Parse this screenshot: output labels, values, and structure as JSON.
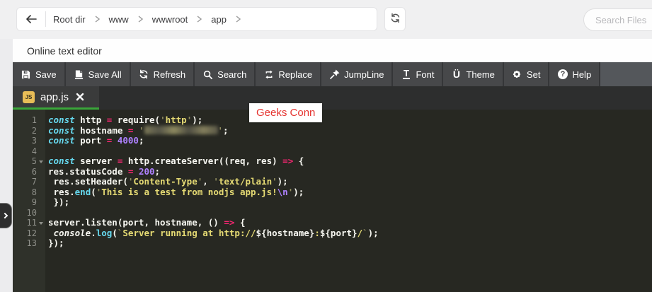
{
  "topbar": {
    "breadcrumb": [
      "Root dir",
      "www",
      "wwwroot",
      "app"
    ],
    "search_placeholder": "Search Files"
  },
  "header": {
    "title": "Online text editor"
  },
  "toolbar": {
    "buttons": [
      {
        "label": "Save",
        "icon": "save-icon"
      },
      {
        "label": "Save All",
        "icon": "save-all-icon"
      },
      {
        "label": "Refresh",
        "icon": "refresh-icon"
      },
      {
        "label": "Search",
        "icon": "search-icon"
      },
      {
        "label": "Replace",
        "icon": "replace-icon"
      },
      {
        "label": "JumpLine",
        "icon": "pin-icon"
      },
      {
        "label": "Font",
        "icon": "font-icon"
      },
      {
        "label": "Theme",
        "icon": "theme-icon"
      },
      {
        "label": "Set",
        "icon": "gear-icon"
      },
      {
        "label": "Help",
        "icon": "help-icon"
      }
    ]
  },
  "tab": {
    "label": "app.js",
    "badge": "JS",
    "underline_color": "#3aa63a",
    "file_icon_color": "#e8bd57"
  },
  "overlay": {
    "label": "Geeks Conn",
    "color": "#e53430"
  },
  "editor": {
    "language": "javascript",
    "theme_colors": {
      "background": "#272822",
      "gutter": "#2f312a",
      "line_number": "#8f908a",
      "keyword": "#66d9ef",
      "operator": "#f92672",
      "string": "#e6db74",
      "string_quote": "#8f8c5e",
      "number": "#ae81ff",
      "text": "#f8f8f2"
    },
    "lines": [
      {
        "n": 1,
        "fold": false,
        "tk": [
          [
            "kw",
            "const"
          ],
          [
            "txt",
            " http "
          ],
          [
            "op",
            "="
          ],
          [
            "txt",
            " require("
          ],
          [
            "strq",
            "'"
          ],
          [
            "str",
            "http"
          ],
          [
            "strq",
            "'"
          ],
          [
            "txt",
            ");"
          ]
        ]
      },
      {
        "n": 2,
        "fold": false,
        "tk": [
          [
            "kw",
            "const"
          ],
          [
            "txt",
            " hostname "
          ],
          [
            "op",
            "="
          ],
          [
            "txt",
            " "
          ],
          [
            "strq",
            "'"
          ],
          [
            "blur",
            ""
          ],
          [
            "strq",
            "'"
          ],
          [
            "txt",
            ";"
          ]
        ]
      },
      {
        "n": 3,
        "fold": false,
        "tk": [
          [
            "kw",
            "const"
          ],
          [
            "txt",
            " port "
          ],
          [
            "op",
            "="
          ],
          [
            "txt",
            " "
          ],
          [
            "num",
            "4000"
          ],
          [
            "txt",
            ";"
          ]
        ]
      },
      {
        "n": 4,
        "fold": false,
        "tk": []
      },
      {
        "n": 5,
        "fold": true,
        "tk": [
          [
            "kw",
            "const"
          ],
          [
            "txt",
            " server "
          ],
          [
            "op",
            "="
          ],
          [
            "txt",
            " http.createServer((req, res) "
          ],
          [
            "op",
            "=>"
          ],
          [
            "txt",
            " {"
          ]
        ]
      },
      {
        "n": 6,
        "fold": false,
        "tk": [
          [
            "txt",
            "res.statusCode "
          ],
          [
            "op",
            "="
          ],
          [
            "txt",
            " "
          ],
          [
            "num",
            "200"
          ],
          [
            "txt",
            ";"
          ]
        ]
      },
      {
        "n": 7,
        "fold": false,
        "tk": [
          [
            "txt",
            " res.setHeader("
          ],
          [
            "strq",
            "'"
          ],
          [
            "str",
            "Content-Type"
          ],
          [
            "strq",
            "'"
          ],
          [
            "txt",
            ", "
          ],
          [
            "strq",
            "'"
          ],
          [
            "str",
            "text/plain"
          ],
          [
            "strq",
            "'"
          ],
          [
            "txt",
            ");"
          ]
        ]
      },
      {
        "n": 8,
        "fold": false,
        "tk": [
          [
            "txt",
            " res."
          ],
          [
            "fn",
            "end"
          ],
          [
            "txt",
            "("
          ],
          [
            "strq",
            "'"
          ],
          [
            "str",
            "This is a test from nodjs app.js!"
          ],
          [
            "esc",
            "\\n"
          ],
          [
            "strq",
            "'"
          ],
          [
            "txt",
            ");"
          ]
        ]
      },
      {
        "n": 9,
        "fold": false,
        "tk": [
          [
            "txt",
            " });"
          ]
        ]
      },
      {
        "n": 10,
        "fold": false,
        "tk": []
      },
      {
        "n": 11,
        "fold": true,
        "tk": [
          [
            "txt",
            "server.listen(port, hostname, () "
          ],
          [
            "op",
            "=>"
          ],
          [
            "txt",
            " {"
          ]
        ]
      },
      {
        "n": 12,
        "fold": false,
        "tk": [
          [
            "txt",
            " "
          ],
          [
            "it",
            "console"
          ],
          [
            "txt",
            "."
          ],
          [
            "fn",
            "log"
          ],
          [
            "txt",
            "("
          ],
          [
            "strq",
            "`"
          ],
          [
            "str",
            "Server running at http://"
          ],
          [
            "txt",
            "${hostname}"
          ],
          [
            "str",
            ":"
          ],
          [
            "txt",
            "${port}"
          ],
          [
            "str",
            "/"
          ],
          [
            "strq",
            "`"
          ],
          [
            "txt",
            ");"
          ]
        ]
      },
      {
        "n": 13,
        "fold": false,
        "tk": [
          [
            "txt",
            "});"
          ]
        ]
      }
    ]
  }
}
